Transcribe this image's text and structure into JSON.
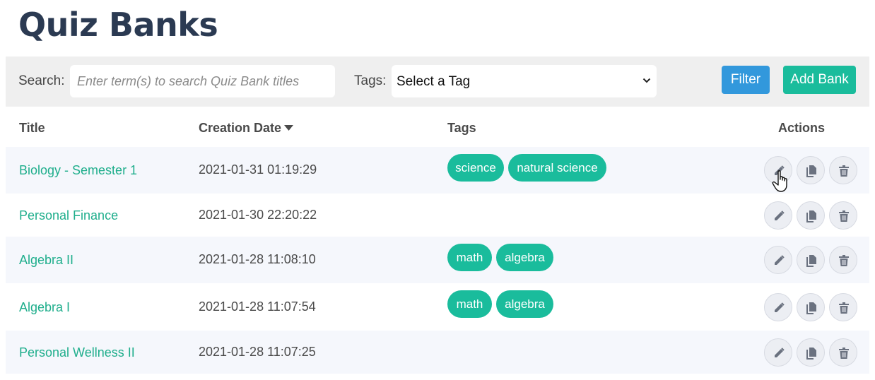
{
  "page": {
    "title": "Quiz Banks"
  },
  "toolbar": {
    "search_label": "Search:",
    "search_placeholder": "Enter term(s) to search Quiz Bank titles",
    "search_value": "",
    "tags_label": "Tags:",
    "tags_selected": "Select a Tag",
    "filter_label": "Filter",
    "add_label": "Add Bank"
  },
  "table": {
    "headers": {
      "title": "Title",
      "date": "Creation Date",
      "tags": "Tags",
      "actions": "Actions"
    },
    "sort": {
      "column": "Creation Date",
      "direction": "descending"
    },
    "rows": [
      {
        "title": "Biology - Semester 1",
        "date": "2021-01-31 01:19:29",
        "tags": [
          "science",
          "natural science"
        ]
      },
      {
        "title": "Personal Finance",
        "date": "2021-01-30 22:20:22",
        "tags": []
      },
      {
        "title": "Algebra II",
        "date": "2021-01-28 11:08:10",
        "tags": [
          "math",
          "algebra"
        ]
      },
      {
        "title": "Algebra I",
        "date": "2021-01-28 11:07:54",
        "tags": [
          "math",
          "algebra"
        ]
      },
      {
        "title": "Personal Wellness II",
        "date": "2021-01-28 11:07:25",
        "tags": []
      }
    ],
    "row_actions": [
      {
        "name": "edit",
        "icon": "pencil-icon"
      },
      {
        "name": "duplicate",
        "icon": "copy-icon"
      },
      {
        "name": "delete",
        "icon": "trash-icon"
      }
    ]
  },
  "colors": {
    "title": "#2b3a52",
    "link": "#1fae8c",
    "tag": "#1abc9c",
    "filter_button": "#3298dc",
    "add_button": "#1abc9c",
    "toolbar_bg": "#efefef",
    "stripe": "#f5f7fc"
  }
}
